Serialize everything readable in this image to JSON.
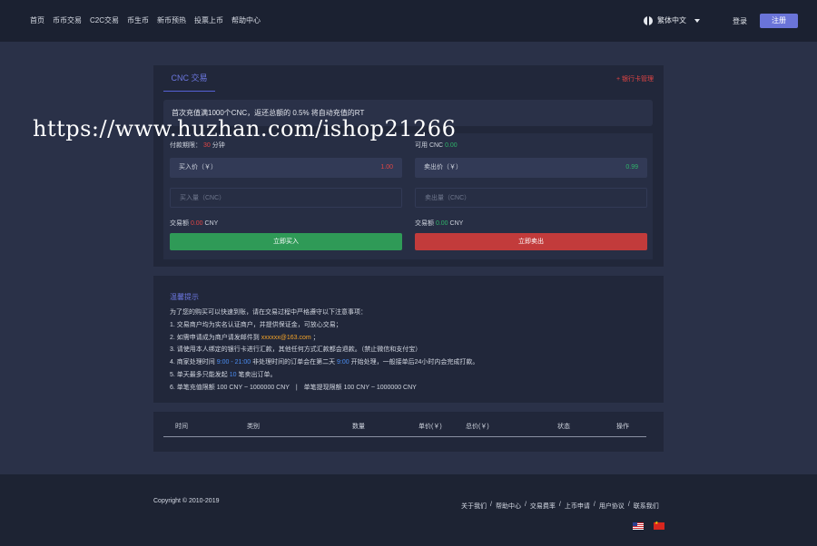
{
  "header": {
    "nav": [
      "首页",
      "币币交易",
      "C2C交易",
      "币生币",
      "新币预热",
      "投票上币",
      "帮助中心"
    ],
    "language": "繁体中文",
    "login": "登录",
    "register": "注册"
  },
  "trade": {
    "tab": "CNC 交易",
    "bank_card": "+ 银行卡管理",
    "notice": "首次充值满1000个CNC，返还总额的 0.5% 将自动充值的RT",
    "buy": {
      "countdown_label": "付款期限：",
      "countdown_value": "30",
      "countdown_unit": "分钟",
      "price_label": "买入价（￥）",
      "price_value": "1.00",
      "amount_placeholder": "买入量（CNC）",
      "total_label": "交易额",
      "total_value": "0.00",
      "total_unit": "CNY",
      "button": "立即买入"
    },
    "sell": {
      "available_label": "可用 CNC",
      "available_value": "0.00",
      "price_label": "卖出价（￥）",
      "price_value": "0.99",
      "amount_placeholder": "卖出量（CNC）",
      "total_label": "交易额",
      "total_value": "0.00",
      "total_unit": "CNY",
      "button": "立即卖出"
    }
  },
  "tips": {
    "title": "温馨提示",
    "intro": "为了您的购买可以快速到账，请在交易过程中严格遵守以下注意事项：",
    "line1": "1. 交易商户均为实名认证商户，并提供保证金，可放心交易；",
    "line2_a": "2. 如需申请成为商户请发邮件到",
    "line2_email": "xxxxxx@163.com",
    "line2_b": "；",
    "line3": "3. 请使用本人绑定的银行卡进行汇款，其他任何方式汇款都会退款。（禁止微信和支付宝）",
    "line4_a": "4. 商家处理时间",
    "line4_time": "9:00 - 21:00",
    "line4_b": "非处理时间的订单会在第二天",
    "line4_time2": "9:00",
    "line4_c": "开始处理，一般接单后24小时内会完成打款。",
    "line5_a": "5. 单天最多只能发起",
    "line5_count": "10",
    "line5_b": "笔卖出订单。",
    "line6": "6. 单笔充值限额 100 CNY ~ 1000000 CNY　|　单笔提现限额 100 CNY ~ 1000000 CNY"
  },
  "orders": {
    "columns": [
      "时间",
      "类别",
      "数量",
      "单价(￥)",
      "总价(￥)",
      "状态",
      "操作"
    ]
  },
  "watermark": "https://www.huzhan.com/ishop21266",
  "footer": {
    "copyright": "Copyright © 2010-2019",
    "links": [
      "关于我们",
      "帮助中心",
      "交易费率",
      "上币申请",
      "用户协议",
      "联系我们"
    ],
    "separator": "/"
  },
  "colors": {
    "accent": "#6a74d8",
    "buy": "#2f9a57",
    "sell": "#c23b3b",
    "background": "#2a3148"
  }
}
